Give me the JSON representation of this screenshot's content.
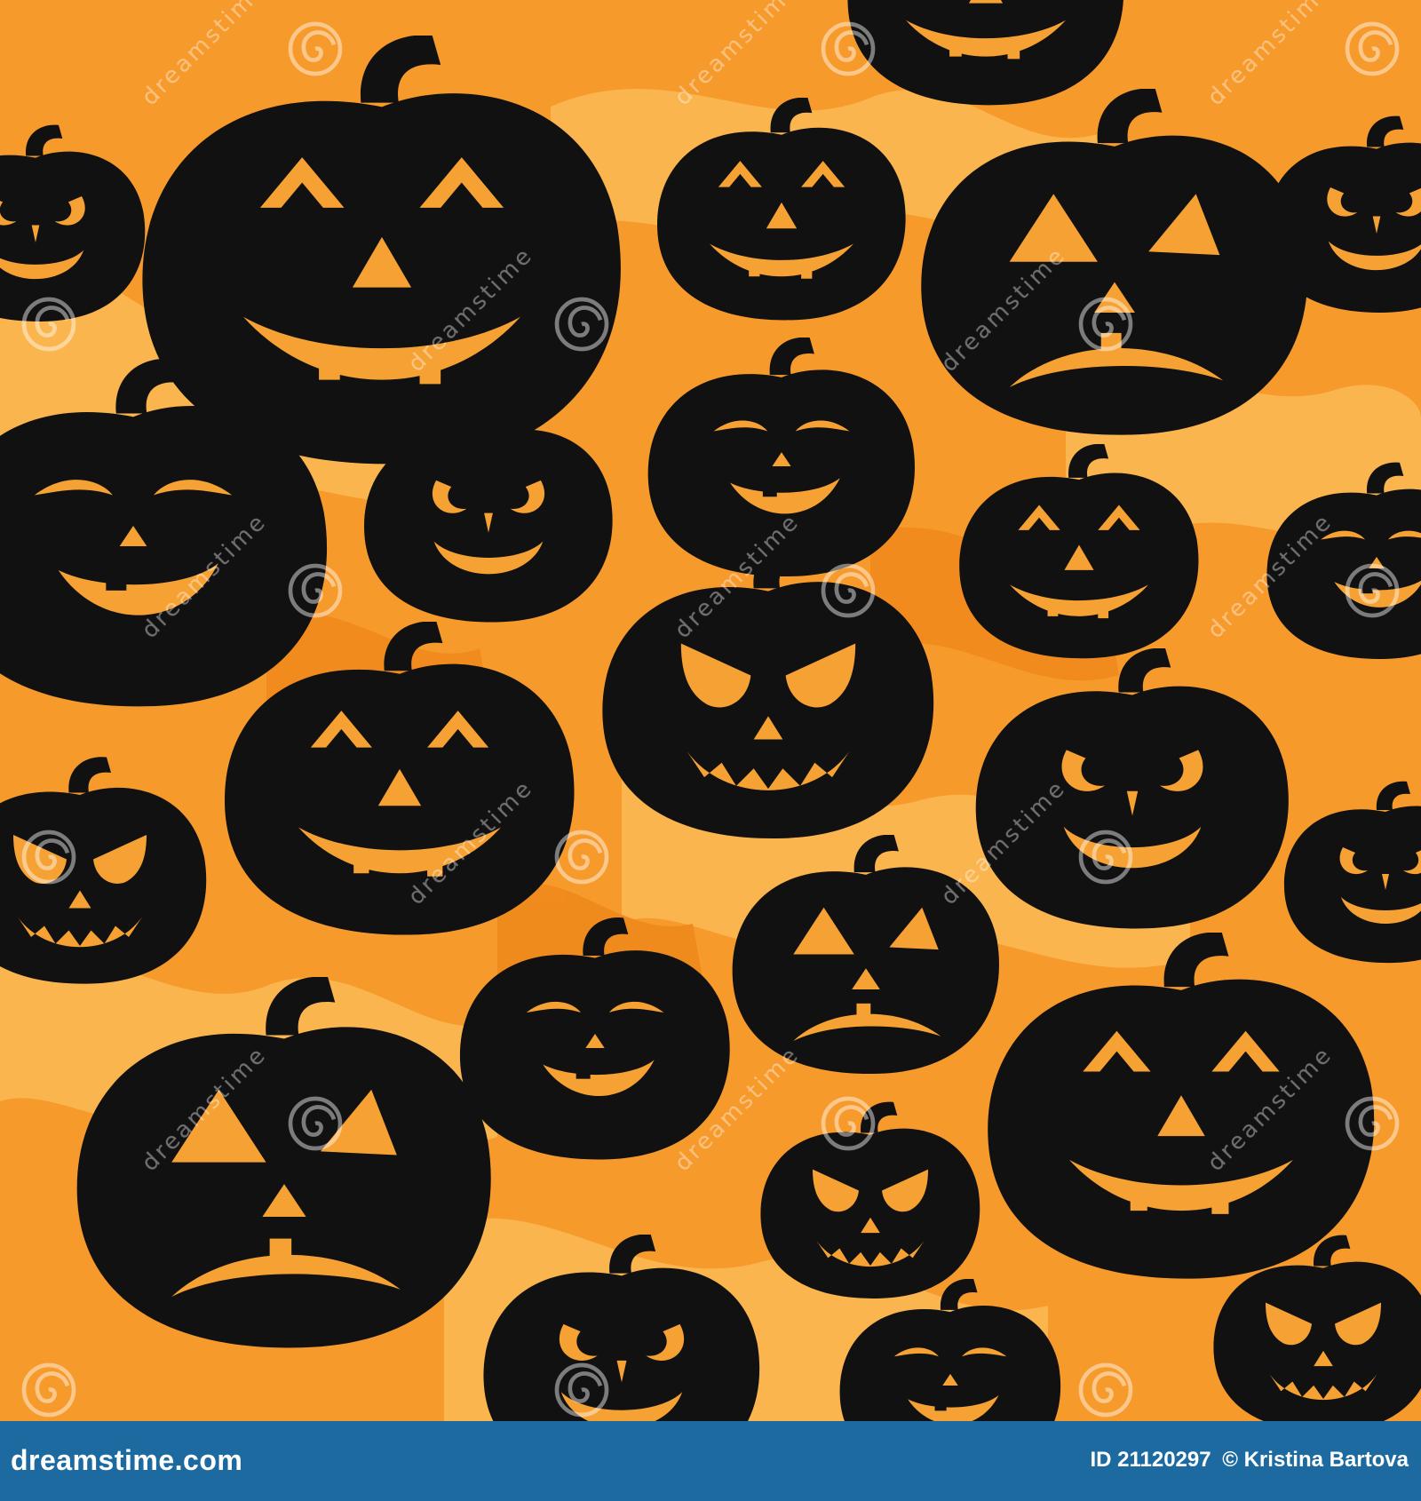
{
  "image": {
    "subject": "seamless pattern of black jack-o'-lantern pumpkin silhouettes on an orange background",
    "colors": {
      "background_light": "#fbb852",
      "background_mid": "#f79a2c",
      "background_dark": "#ef8a1c",
      "pumpkin": "#111111",
      "carved_face": "#f6a133",
      "watermark": "#ffffff",
      "footer_bar": "#1d6aa1",
      "footer_text": "#ffffff"
    },
    "pumpkin_faces": [
      "smiling",
      "happy",
      "sad",
      "angry",
      "grinning",
      "sly"
    ]
  },
  "watermark": {
    "text": "dreamstime",
    "icon": "swirl-logo-icon"
  },
  "footer": {
    "brand": "dreamstime.com",
    "id_label": "ID 21120297",
    "copyright": "© Kristina Bartova"
  }
}
